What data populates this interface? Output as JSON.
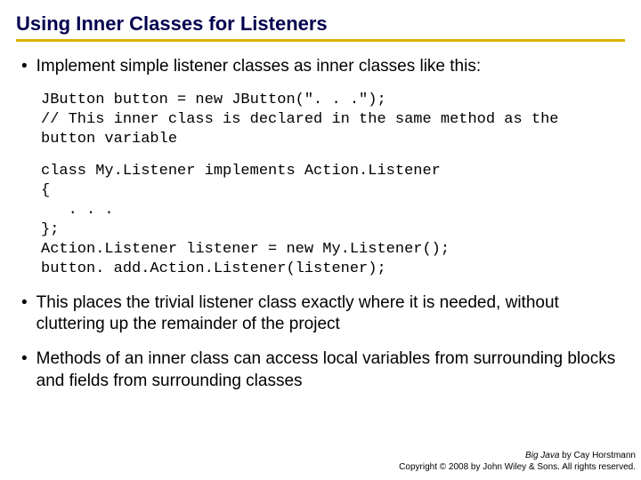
{
  "title": "Using Inner Classes for Listeners",
  "bullets": {
    "b1": "Implement simple listener classes as inner classes like this:",
    "b2": "This places the trivial listener class exactly where it is needed, without cluttering up the remainder of the project",
    "b3": "Methods of an inner class can access local variables from surrounding blocks and fields from surrounding classes"
  },
  "code": {
    "block1": "JButton button = new JButton(\". . .\");\n// This inner class is declared in the same method as the\nbutton variable",
    "block2": "class My.Listener implements Action.Listener\n{\n   . . .\n};\nAction.Listener listener = new My.Listener();\nbutton. add.Action.Listener(listener);"
  },
  "footer": {
    "book": "Big Java",
    "author": " by Cay Horstmann",
    "copyright": "Copyright © 2008 by John Wiley & Sons. All rights reserved."
  }
}
